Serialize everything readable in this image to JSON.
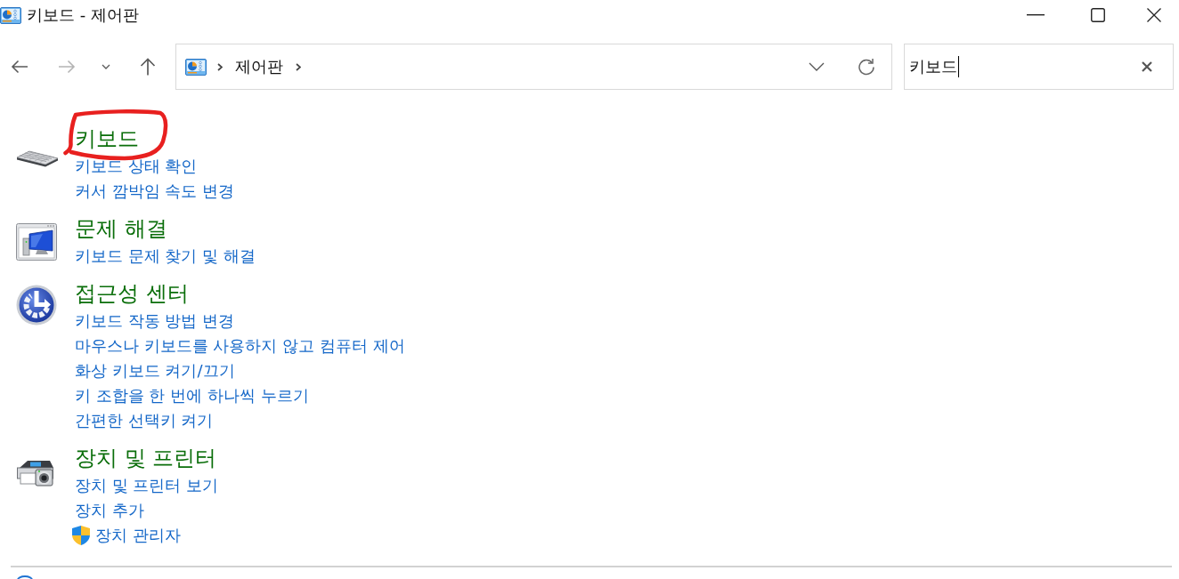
{
  "window": {
    "title": "키보드 - 제어판"
  },
  "navigation": {
    "back": {
      "disabled": false
    },
    "forward": {
      "disabled": true
    }
  },
  "address_bar": {
    "path": [
      "제어판"
    ]
  },
  "search": {
    "value": "키보드"
  },
  "categories": [
    {
      "kind": "keyboard",
      "title": "키보드",
      "highlighted": true,
      "links": [
        {
          "label": "키보드 상태 확인",
          "shield": false
        },
        {
          "label": "커서 깜박임 속도 변경",
          "shield": false
        }
      ]
    },
    {
      "kind": "troubleshooting",
      "title": "문제 해결",
      "highlighted": false,
      "links": [
        {
          "label": "키보드 문제 찾기 및 해결",
          "shield": false
        }
      ]
    },
    {
      "kind": "accessibility",
      "title": "접근성 센터",
      "highlighted": false,
      "links": [
        {
          "label": "키보드 작동 방법 변경",
          "shield": false
        },
        {
          "label": "마우스나 키보드를 사용하지 않고 컴퓨터 제어",
          "shield": false
        },
        {
          "label": "화상 키보드 켜기/끄기",
          "shield": false
        },
        {
          "label": "키 조합을 한 번에 하나씩 누르기",
          "shield": false
        },
        {
          "label": "간편한 선택키 켜기",
          "shield": false
        }
      ]
    },
    {
      "kind": "devices",
      "title": "장치 및 프린터",
      "highlighted": false,
      "links": [
        {
          "label": "장치 및 프린터 보기",
          "shield": false
        },
        {
          "label": "장치 추가",
          "shield": false
        },
        {
          "label": "장치 관리자",
          "shield": true
        }
      ]
    }
  ]
}
